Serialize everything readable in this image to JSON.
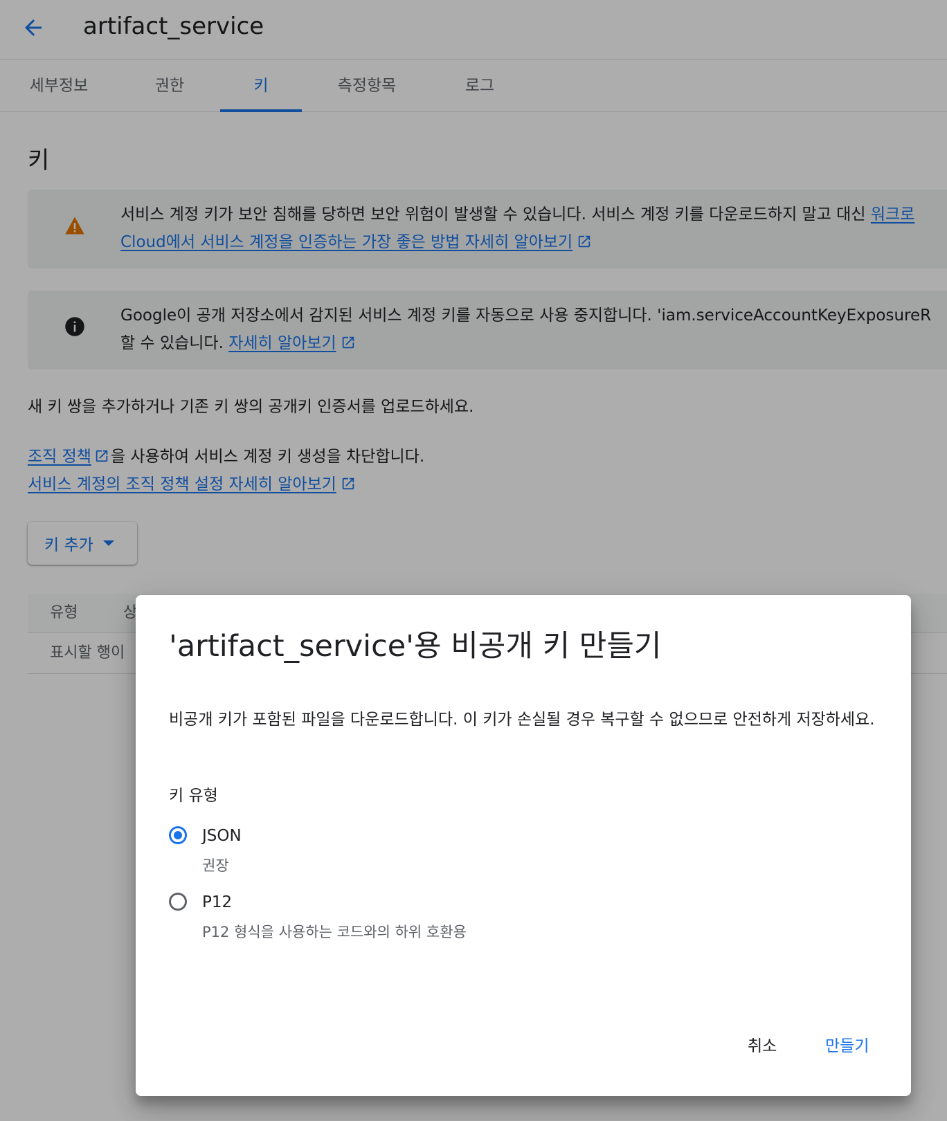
{
  "header": {
    "title": "artifact_service"
  },
  "tabs": [
    {
      "label": "세부정보"
    },
    {
      "label": "권한"
    },
    {
      "label": "키"
    },
    {
      "label": "측정항목"
    },
    {
      "label": "로그"
    }
  ],
  "section": {
    "title": "키"
  },
  "warning_banner": {
    "text_line1": "서비스 계정 키가 보안 침해를 당하면 보안 위험이 발생할 수 있습니다. 서비스 계정 키를 다운로드하지 말고 대신 ",
    "link_line1": "워크로",
    "link_line2": "Cloud에서 서비스 계정을 인증하는 가장 좋은 방법 자세히 알아보기"
  },
  "info_banner": {
    "text_line1": "Google이 공개 저장소에서 감지된 서비스 계정 키를 자동으로 사용 중지합니다. 'iam.serviceAccountKeyExposureR",
    "text_line2": "할 수 있습니다. ",
    "link": "자세히 알아보기"
  },
  "description": "새 키 쌍을 추가하거나 기존 키 쌍의 공개키 인증서를 업로드하세요.",
  "policy": {
    "link1": "조직 정책",
    "text1": "을 사용하여 서비스 계정 키 생성을 차단합니다.",
    "link2": "서비스 계정의 조직 정책 설정 자세히 알아보기"
  },
  "add_key_button": "키 추가",
  "table": {
    "col_type": "유형",
    "col_status": "상",
    "empty": "표시할 행이"
  },
  "dialog": {
    "title": "'artifact_service'용 비공개 키 만들기",
    "description": "비공개 키가 포함된 파일을 다운로드합니다. 이 키가 손실될 경우 복구할 수 없으므로 안전하게 저장하세요.",
    "key_type_label": "키 유형",
    "options": [
      {
        "label": "JSON",
        "sub": "권장",
        "checked": true
      },
      {
        "label": "P12",
        "sub": "P12 형식을 사용하는 코드와의 하위 호환용",
        "checked": false
      }
    ],
    "cancel": "취소",
    "create": "만들기"
  },
  "colors": {
    "accent": "#1a73e8",
    "warning": "#e37400",
    "scrim": "rgba(0,0,0,0.32)"
  },
  "icons": [
    "back-arrow-icon",
    "warning-icon",
    "info-icon",
    "external-link-icon",
    "dropdown-caret-icon"
  ]
}
